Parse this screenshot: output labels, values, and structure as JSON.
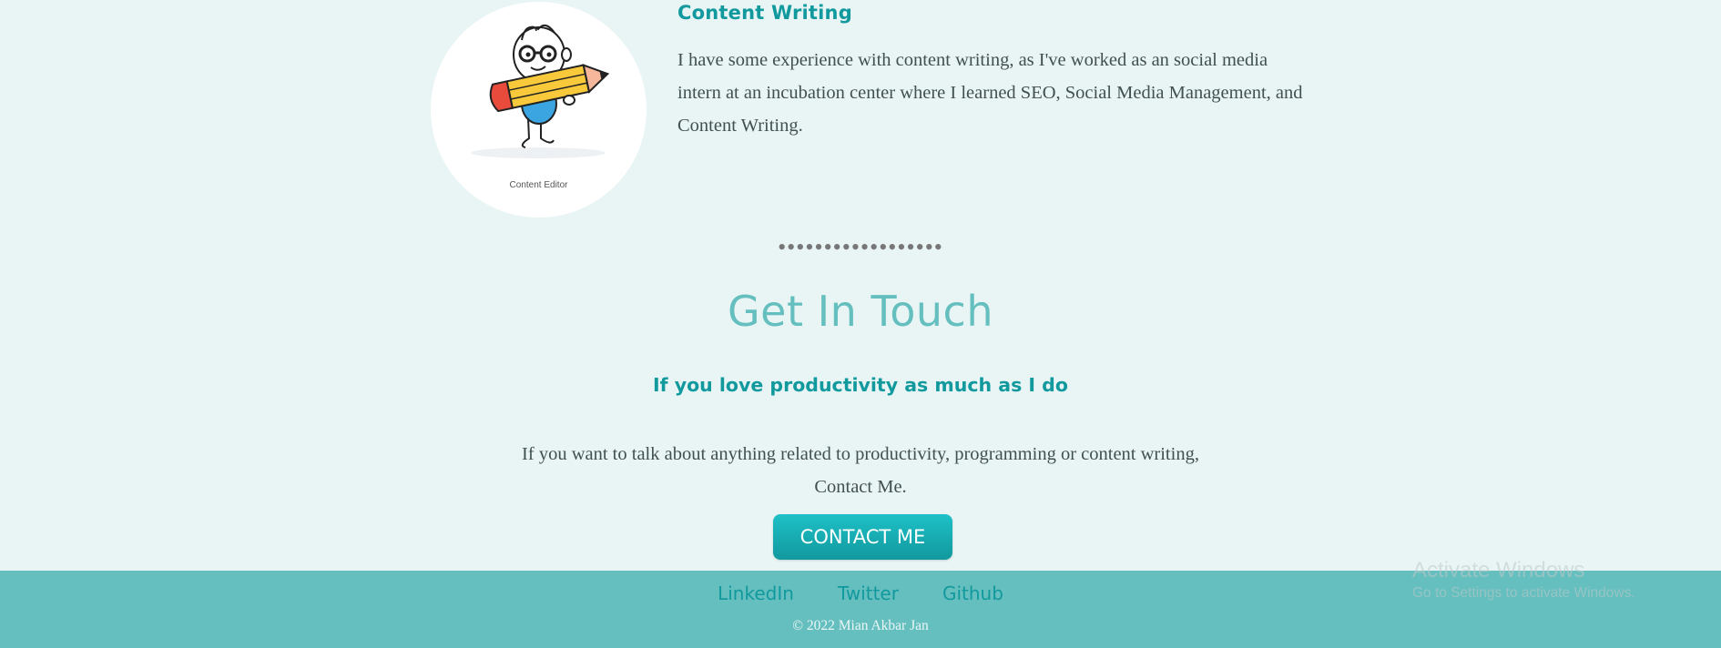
{
  "skill": {
    "title": "Content Writing",
    "description": "I have some experience with content writing, as I've worked as an social media intern at an incubation center where I learned SEO, Social Media Management, and Content Writing.",
    "image_caption": "Content Editor"
  },
  "divider": "••••••••••••••••••",
  "contact": {
    "title": "Get In Touch",
    "subtitle": "If you love productivity as much as I do",
    "text": "If you want to talk about anything related to productivity, programming or content writing, Contact Me.",
    "button_label": "CONTACT ME"
  },
  "footer": {
    "links": [
      "LinkedIn",
      "Twitter",
      "Github"
    ],
    "copyright": "© 2022 Mian Akbar Jan"
  },
  "watermark": {
    "title": "Activate Windows",
    "subtitle": "Go to Settings to activate Windows."
  },
  "colors": {
    "background": "#e8f5f4",
    "accent": "#11999e",
    "heading_light": "#66bfbf",
    "text": "#40514e",
    "footer": "#66bfbf"
  }
}
